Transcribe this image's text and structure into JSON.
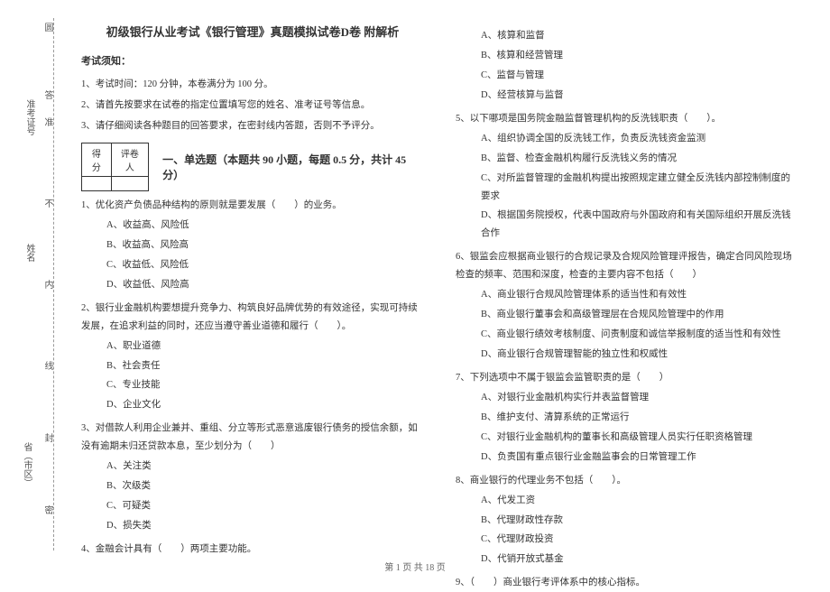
{
  "title": "初级银行从业考试《银行管理》真题模拟试卷D卷 附解析",
  "notice_head": "考试须知：",
  "instructions": [
    "1、考试时间：120 分钟，本卷满分为 100 分。",
    "2、请首先按要求在试卷的指定位置填写您的姓名、准考证号等信息。",
    "3、请仔细阅读各种题目的回答要求，在密封线内答题，否则不予评分。"
  ],
  "score_header": {
    "c1": "得分",
    "c2": "评卷人"
  },
  "section1_title": "一、单选题（本题共 90 小题，每题 0.5 分，共计 45 分）",
  "binding": {
    "seal": "圆",
    "l1": "答",
    "l2": "不",
    "l3": "内",
    "l4": "线",
    "l5": "封",
    "l6": "密"
  },
  "side_labels": {
    "zkz": "准考证号",
    "zkz2": "准",
    "name": "姓名",
    "prov": "省（市区）"
  },
  "left_questions": [
    {
      "stem": "1、优化资产负债品种结构的原则就是要发展（　　）的业务。",
      "opts": [
        "A、收益高、风险低",
        "B、收益高、风险高",
        "C、收益低、风险低",
        "D、收益低、风险高"
      ]
    },
    {
      "stem": "2、银行业金融机构要想提升竞争力、构筑良好品牌优势的有效途径，实现可持续发展，在追求利益的同时，还应当遵守善业道德和履行（　　）。",
      "opts": [
        "A、职业道德",
        "B、社会责任",
        "C、专业技能",
        "D、企业文化"
      ]
    },
    {
      "stem": "3、对借款人利用企业兼并、重组、分立等形式恶意逃废银行债务的授信余额，如没有逾期未归还贷款本息，至少划分为（　　）",
      "opts": [
        "A、关注类",
        "B、次级类",
        "C、可疑类",
        "D、损失类"
      ]
    },
    {
      "stem": "4、金融会计具有（　　）两项主要功能。",
      "opts": []
    }
  ],
  "right_questions": [
    {
      "stem": "",
      "opts": [
        "A、核算和监督",
        "B、核算和经营管理",
        "C、监督与管理",
        "D、经营核算与监督"
      ]
    },
    {
      "stem": "5、以下哪项是国务院金融监督管理机构的反洗钱职责（　　）。",
      "opts": [
        "A、组织协调全国的反洗钱工作，负责反洗钱资金监测",
        "B、监督、检查金融机构履行反洗钱义务的情况",
        "C、对所监督管理的金融机构提出按照规定建立健全反洗钱内部控制制度的要求",
        "D、根据国务院授权，代表中国政府与外国政府和有关国际组织开展反洗钱合作"
      ]
    },
    {
      "stem": "6、银监会应根据商业银行的合规记录及合规风险管理评报告，确定合同风险现场检查的频率、范围和深度，检查的主要内容不包括（　　）",
      "opts": [
        "A、商业银行合规风险管理体系的适当性和有效性",
        "B、商业银行董事会和高级管理层在合规风险管理中的作用",
        "C、商业银行绩效考核制度、问责制度和诚信举报制度的适当性和有效性",
        "D、商业银行合规管理智能的独立性和权威性"
      ]
    },
    {
      "stem": "7、下列选项中不属于银监会监管职责的是（　　）",
      "opts": [
        "A、对银行业金融机构实行并表监督管理",
        "B、维护支付、清算系统的正常运行",
        "C、对银行业金融机构的董事长和高级管理人员实行任职资格管理",
        "D、负责国有重点银行业金融监事会的日常管理工作"
      ]
    },
    {
      "stem": "8、商业银行的代理业务不包括（　　）。",
      "opts": [
        "A、代发工资",
        "B、代理财政性存款",
        "C、代理财政投资",
        "D、代销开放式基金"
      ]
    },
    {
      "stem": "9、（　　）商业银行考评体系中的核心指标。",
      "opts": []
    }
  ],
  "footer": "第 1 页 共 18 页"
}
